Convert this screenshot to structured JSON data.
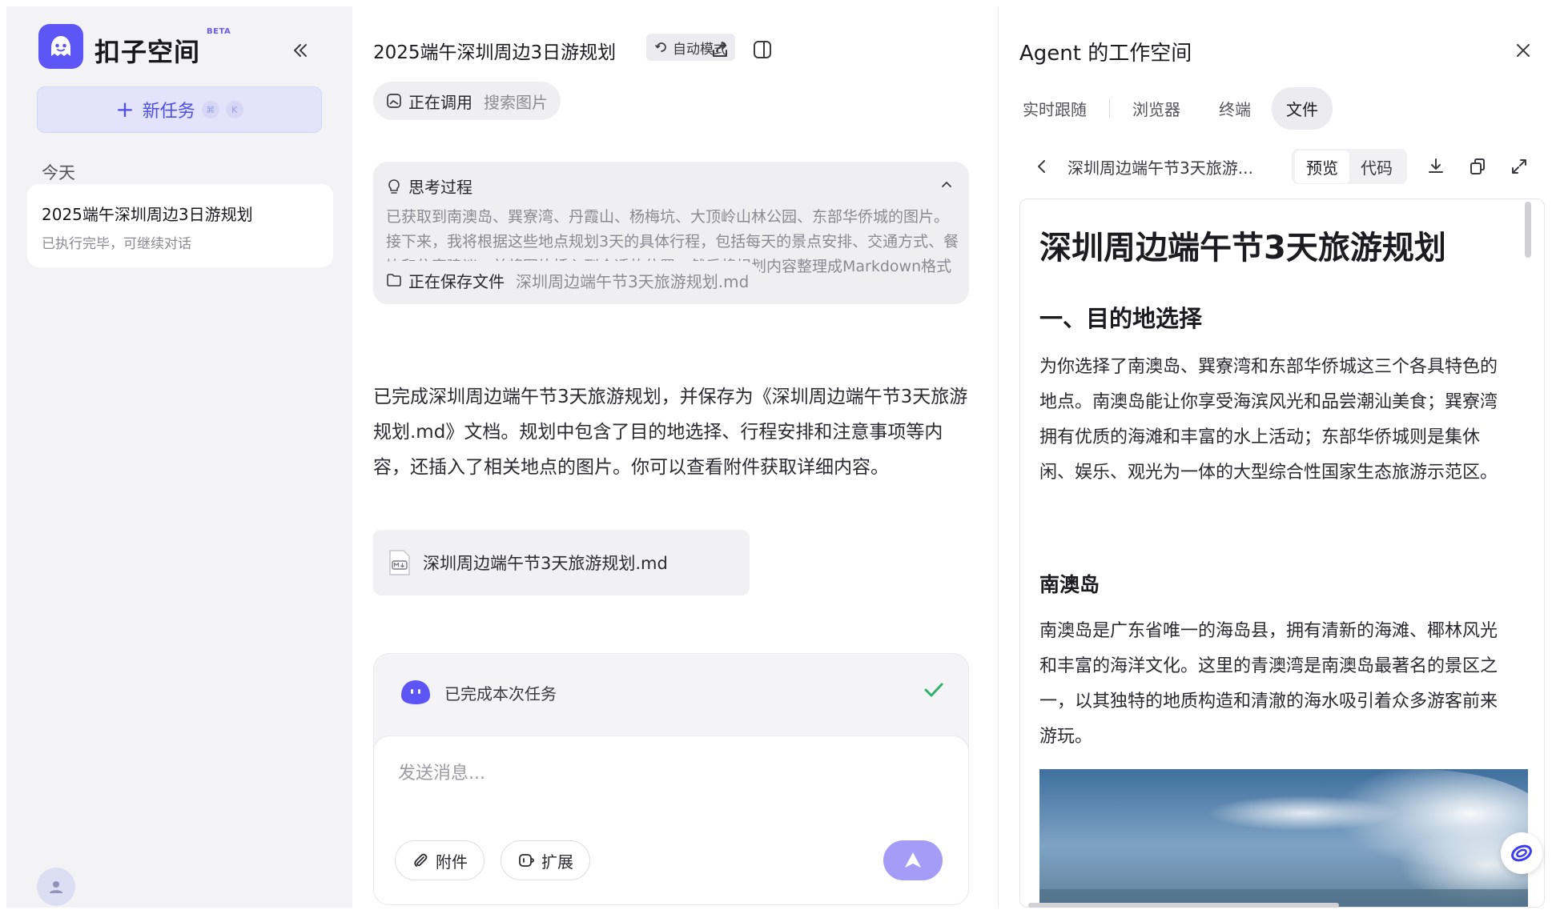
{
  "sidebar": {
    "brand": "扣子空间",
    "beta_badge": "BETA",
    "new_task_label": "新任务",
    "shortcut_keys": [
      "⌘",
      "K"
    ],
    "section_today": "今天",
    "tasks": [
      {
        "title": "2025端午深圳周边3日游规划",
        "status": "已执行完毕，可继续对话"
      }
    ]
  },
  "chat": {
    "title": "2025端午深圳周边3日游规划",
    "mode_label": "自动模式",
    "steps": [
      {
        "label": "正在调用",
        "value": "搜索图片"
      },
      {
        "label": "正在保存文件",
        "value": "深圳周边端午节3天旅游规划.md"
      }
    ],
    "thinking": {
      "title": "思考过程",
      "body": "已获取到南澳岛、巽寮湾、丹霞山、杨梅坑、大顶岭山林公园、东部华侨城的图片。接下来，我将根据这些地点规划3天的具体行程，包括每天的景点安排、交通方式、餐饮和住宿建议，并将图片插入到合适的位置，然后将规划内容整理成Markdown格式的文档。"
    },
    "answer": "已完成深圳周边端午节3天旅游规划，并保存为《深圳周边端午节3天旅游规划.md》文档。规划中包含了目的地选择、行程安排和注意事项等内容，还插入了相关地点的图片。你可以查看附件获取详细内容。",
    "attachment": {
      "name": "深圳周边端午节3天旅游规划.md",
      "icon": "markdown-file-icon"
    },
    "completed_label": "已完成本次任务",
    "input_placeholder": "发送消息...",
    "attach_label": "附件",
    "extend_label": "扩展"
  },
  "agent_panel": {
    "title": "Agent 的工作空间",
    "tabs": [
      "实时跟随",
      "浏览器",
      "终端",
      "文件"
    ],
    "active_tab": "文件",
    "doc_name": "深圳周边端午节3天旅游...",
    "view_modes": [
      "预览",
      "代码"
    ],
    "active_view": "预览",
    "document": {
      "h1": "深圳周边端午节3天旅游规划",
      "h2": "一、目的地选择",
      "p1": "为你选择了南澳岛、巽寮湾和东部华侨城这三个各具特色的地点。南澳岛能让你享受海滨风光和品尝潮汕美食；巽寮湾拥有优质的海滩和丰富的水上活动；东部华侨城则是集休闲、娱乐、观光为一体的大型综合性国家生态旅游示范区。",
      "h3": "南澳岛",
      "p2": "南澳岛是广东省唯一的海岛县，拥有清新的海滩、椰林风光和丰富的海洋文化。这里的青澳湾是南澳岛最著名的景区之一，以其独特的地质构造和清澈的海水吸引着众多游客前来游玩。"
    }
  },
  "colors": {
    "accent": "#5e55f7",
    "send_button": "#a49cf7",
    "success": "#2fb36b",
    "sidebar_bg": "#f3f3f5"
  }
}
